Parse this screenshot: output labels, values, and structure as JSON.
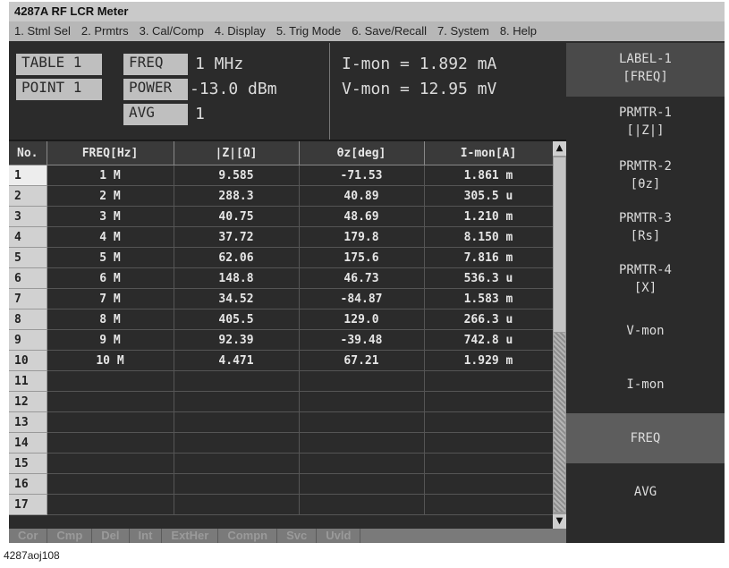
{
  "window": {
    "title": "4287A RF LCR Meter"
  },
  "menu": [
    "1. Stml Sel",
    "2. Prmtrs",
    "3. Cal/Comp",
    "4. Display",
    "5. Trig Mode",
    "6. Save/Recall",
    "7. System",
    "8. Help"
  ],
  "info": {
    "table": "TABLE 1",
    "point": "POINT 1",
    "freq_label": "FREQ",
    "freq_value": "1 MHz",
    "power_label": "POWER",
    "power_value": "-13.0 dBm",
    "avg_label": "AVG",
    "avg_value": "1",
    "imon": "I-mon = 1.892 mA",
    "vmon": "V-mon = 12.95 mV"
  },
  "table": {
    "headers": [
      "No.",
      "FREQ[Hz]",
      "|Z|[Ω]",
      "θz[deg]",
      "I-mon[A]"
    ],
    "rows": [
      [
        "1",
        "1 M",
        "9.585",
        "-71.53",
        "1.861 m"
      ],
      [
        "2",
        "2 M",
        "288.3",
        "40.89",
        "305.5 u"
      ],
      [
        "3",
        "3 M",
        "40.75",
        "48.69",
        "1.210 m"
      ],
      [
        "4",
        "4 M",
        "37.72",
        "179.8",
        "8.150 m"
      ],
      [
        "5",
        "5 M",
        "62.06",
        "175.6",
        "7.816 m"
      ],
      [
        "6",
        "6 M",
        "148.8",
        "46.73",
        "536.3 u"
      ],
      [
        "7",
        "7 M",
        "34.52",
        "-84.87",
        "1.583 m"
      ],
      [
        "8",
        "8 M",
        "405.5",
        "129.0",
        "266.3 u"
      ],
      [
        "9",
        "9 M",
        "92.39",
        "-39.48",
        "742.8 u"
      ],
      [
        "10",
        "10 M",
        "4.471",
        "67.21",
        "1.929 m"
      ],
      [
        "11",
        "",
        "",
        "",
        ""
      ],
      [
        "12",
        "",
        "",
        "",
        ""
      ],
      [
        "13",
        "",
        "",
        "",
        ""
      ],
      [
        "14",
        "",
        "",
        "",
        ""
      ],
      [
        "15",
        "",
        "",
        "",
        ""
      ],
      [
        "16",
        "",
        "",
        "",
        ""
      ],
      [
        "17",
        "",
        "",
        "",
        ""
      ]
    ]
  },
  "status": [
    "Cor",
    "Cmp",
    "Del",
    "Int",
    "ExtHer",
    "Compn",
    "Svc",
    "Uvld"
  ],
  "softkeys": {
    "label1": [
      "LABEL-1",
      "[FREQ]"
    ],
    "prmtr1": [
      "PRMTR-1",
      "[|Z|]"
    ],
    "prmtr2": [
      "PRMTR-2",
      "[θz]"
    ],
    "prmtr3": [
      "PRMTR-3",
      "[Rs]"
    ],
    "prmtr4": [
      "PRMTR-4",
      "[X]"
    ],
    "vmon": "V-mon",
    "imon": "I-mon",
    "freq": "FREQ",
    "avg": "AVG"
  },
  "caption": "4287aoj108"
}
